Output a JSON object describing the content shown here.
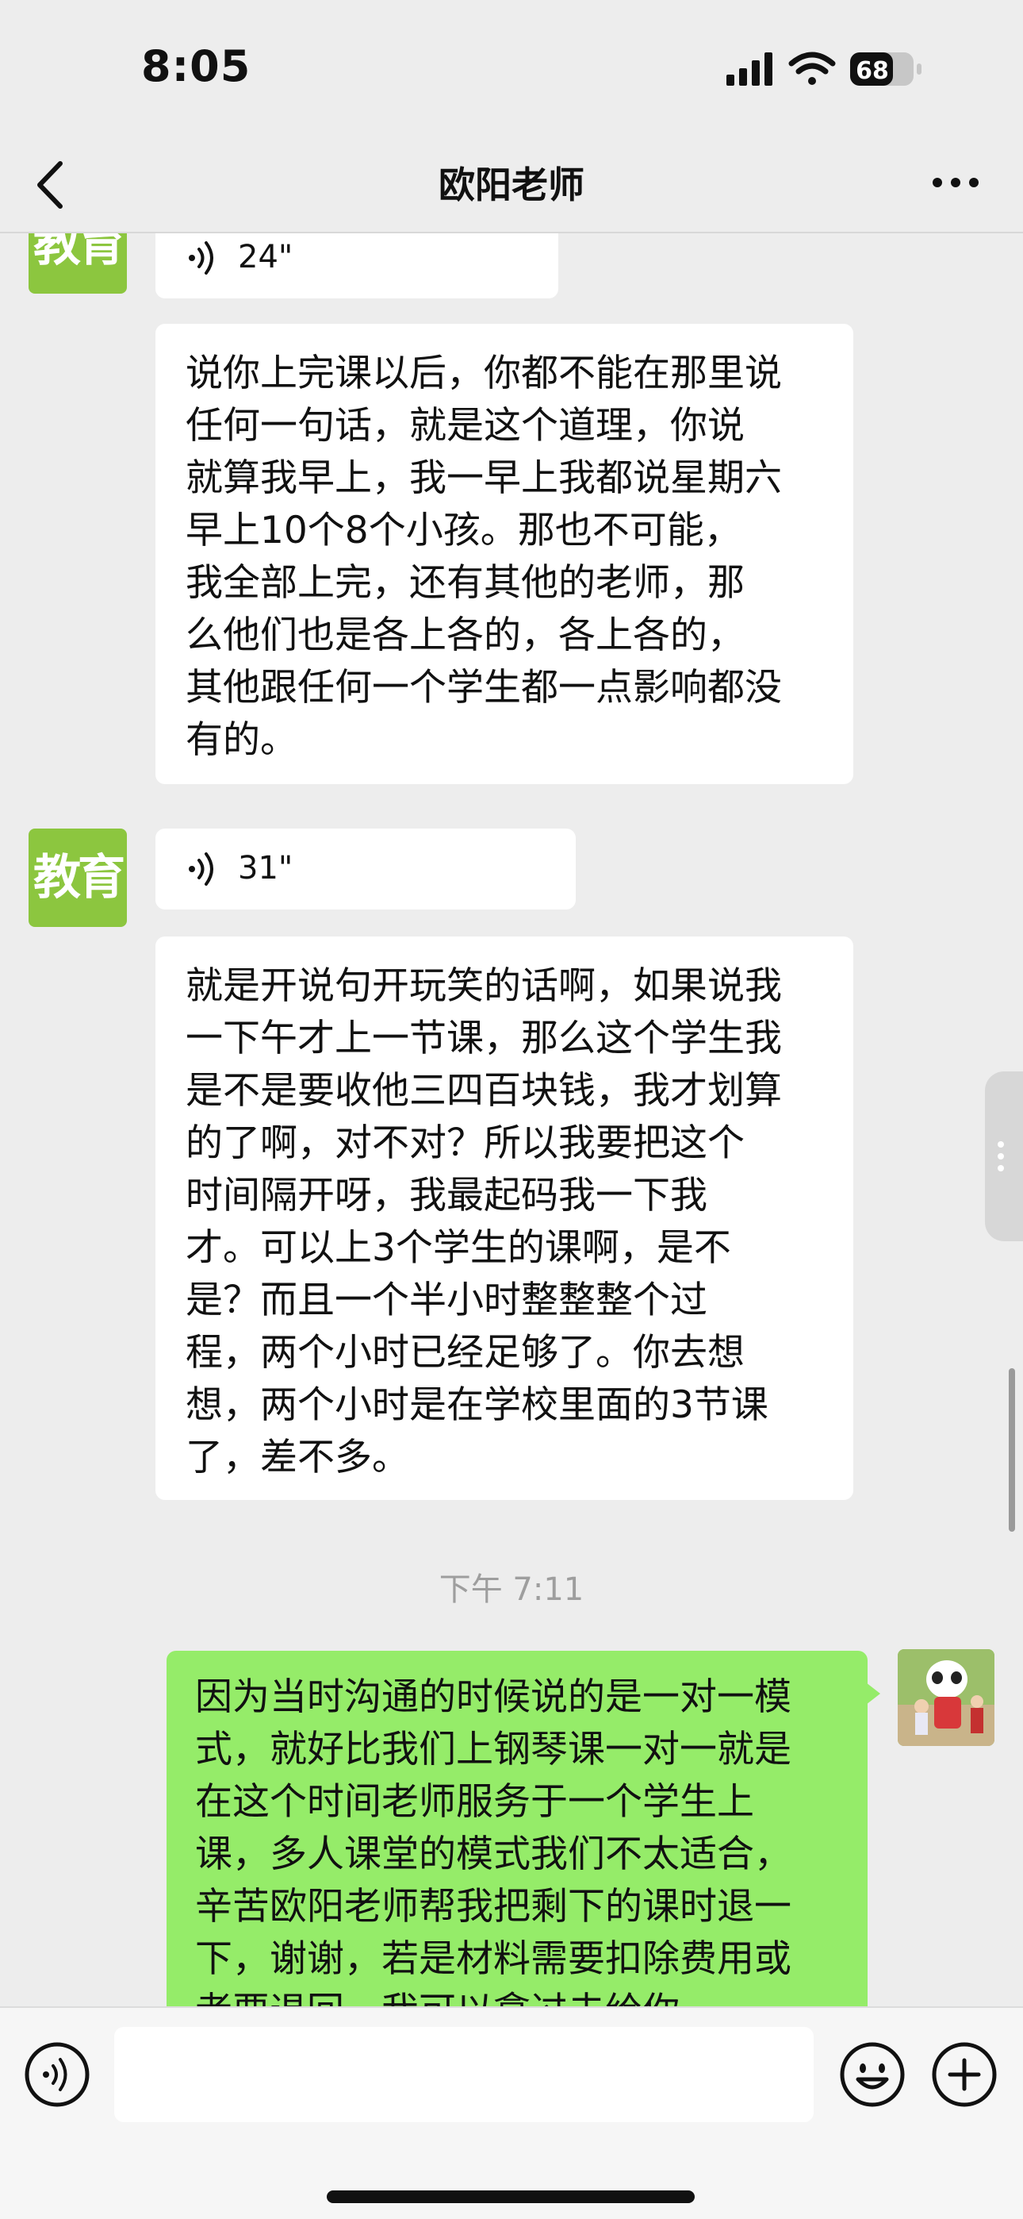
{
  "status_bar": {
    "time": "8:05",
    "battery": "68"
  },
  "nav": {
    "title": "欧阳老师"
  },
  "messages": [
    {
      "avatar_text": "教育",
      "voice_duration": "24\""
    },
    {
      "text": "说你上完课以后，你都不能在那里说\n任何一句话，就是这个道理，你说\n就算我早上，我一早上我都说星期六\n早上10个8个小孩。那也不可能，\n我全部上完，还有其他的老师，那\n么他们也是各上各的，各上各的，\n其他跟任何一个学生都一点影响都没\n有的。"
    },
    {
      "avatar_text": "教育",
      "voice_duration": "31\""
    },
    {
      "text": "就是开说句开玩笑的话啊，如果说我\n一下午才上一节课，那么这个学生我\n是不是要收他三四百块钱，我才划算\n的了啊，对不对？所以我要把这个\n时间隔开呀，我最起码我一下我\n才。可以上3个学生的课啊，是不\n是？而且一个半小时整整整个过\n程，两个小时已经足够了。你去想\n想，两个小时是在学校里面的3节课\n了，差不多。"
    },
    {
      "timestamp": "下午 7:11"
    },
    {
      "text": "因为当时沟通的时候说的是一对一模\n式，就好比我们上钢琴课一对一就是\n在这个时间老师服务于一个学生上\n课，多人课堂的模式我们不太适合，\n辛苦欧阳老师帮我把剩下的课时退一\n下，谢谢，若是材料需要扣除费用或\n者要退回，我可以拿过去给你"
    }
  ],
  "input": {
    "value": "",
    "placeholder": ""
  },
  "colors": {
    "background": "#ededed",
    "my_bubble": "#95ec69",
    "their_bubble": "#ffffff",
    "edu_avatar": "#8cc63f"
  }
}
